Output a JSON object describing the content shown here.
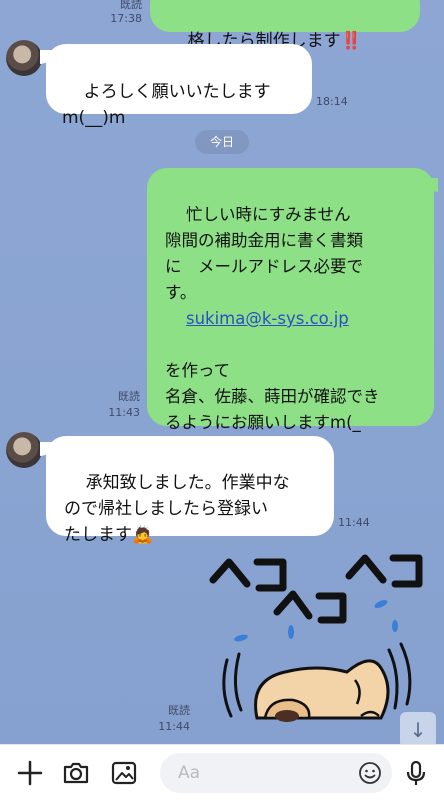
{
  "messages": {
    "m0": {
      "text": "格したら制作します‼️",
      "read": "既読",
      "time": "17:38"
    },
    "m1": {
      "text": "よろしく願いいたします\nm(__)m",
      "time": "18:14"
    },
    "date_pill": "今日",
    "m2": {
      "line1": "忙しい時にすみません\n隙間の補助金用に書く書類\nに　メールアドレス必要で\nす。",
      "email": "sukima@k-sys.co.jp",
      "line2": "を作って\n名倉、佐藤、蒔田が確認でき\nるようにお願いしますm(_\n_)m",
      "read": "既読",
      "time": "11:43"
    },
    "m3": {
      "text": "承知致しました。作業中な\nので帰社しましたら登録い\nたします🙇",
      "time": "11:44"
    },
    "m4": {
      "read": "既読",
      "time": "11:44",
      "sticker_text": "ヘコ"
    }
  },
  "input": {
    "placeholder": "Aa"
  },
  "colors": {
    "outgoing": "#8de085",
    "incoming": "#ffffff",
    "background": "#8aa4d2"
  }
}
